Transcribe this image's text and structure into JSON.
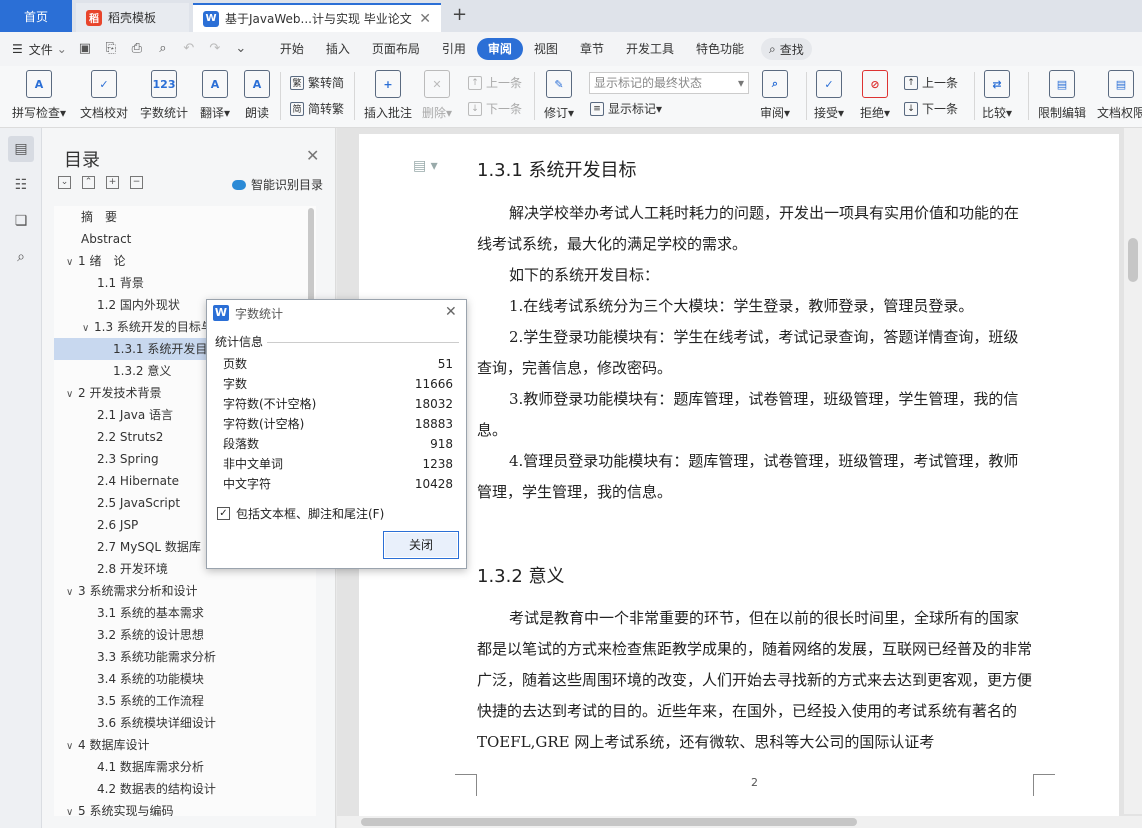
{
  "tabs": {
    "home": "首页",
    "template": "稻壳模板",
    "doc": "基于JavaWeb...计与实现 毕业论文"
  },
  "menubar": {
    "file": "文件",
    "menus": [
      "开始",
      "插入",
      "页面布局",
      "引用",
      "审阅",
      "视图",
      "章节",
      "开发工具",
      "特色功能"
    ],
    "search": "查找"
  },
  "ribbon": {
    "spellcheck": "拼写检查",
    "proofread": "文档校对",
    "wordcount": "字数统计",
    "translate": "翻译",
    "read": "朗读",
    "trad": "繁转简",
    "simp": "简转繁",
    "insert_comment": "插入批注",
    "delete": "删除",
    "prev1": "上一条",
    "next1": "下一条",
    "revise": "修订",
    "mark_status": "显示标记的最终状态",
    "show_marks": "显示标记",
    "review": "审阅",
    "accept": "接受",
    "reject": "拒绝",
    "prev2": "上一条",
    "next2": "下一条",
    "compare": "比较",
    "restrict": "限制编辑",
    "doc_perm": "文档权限"
  },
  "toc": {
    "title": "目录",
    "smart": "智能识别目录",
    "items": [
      {
        "text": "摘　要",
        "level": 0,
        "arrow": ""
      },
      {
        "text": "Abstract",
        "level": 0,
        "arrow": ""
      },
      {
        "text": "1 绪　论",
        "level": 0,
        "arrow": "∨"
      },
      {
        "text": "1.1 背景",
        "level": 1,
        "arrow": ""
      },
      {
        "text": "1.2 国内外现状",
        "level": 1,
        "arrow": ""
      },
      {
        "text": "1.3 系统开发的目标与意义",
        "level": 1,
        "arrow": "∨"
      },
      {
        "text": "1.3.1 系统开发目标",
        "level": 2,
        "arrow": "",
        "selected": true
      },
      {
        "text": "1.3.2 意义",
        "level": 2,
        "arrow": ""
      },
      {
        "text": "2 开发技术背景",
        "level": 0,
        "arrow": "∨"
      },
      {
        "text": "2.1 Java 语言",
        "level": 1,
        "arrow": ""
      },
      {
        "text": "2.2 Struts2",
        "level": 1,
        "arrow": ""
      },
      {
        "text": "2.3 Spring",
        "level": 1,
        "arrow": ""
      },
      {
        "text": "2.4 Hibernate",
        "level": 1,
        "arrow": ""
      },
      {
        "text": "2.5 JavaScript",
        "level": 1,
        "arrow": ""
      },
      {
        "text": "2.6 JSP",
        "level": 1,
        "arrow": ""
      },
      {
        "text": "2.7 MySQL 数据库",
        "level": 1,
        "arrow": ""
      },
      {
        "text": "2.8 开发环境",
        "level": 1,
        "arrow": ""
      },
      {
        "text": "3 系统需求分析和设计",
        "level": 0,
        "arrow": "∨"
      },
      {
        "text": "3.1 系统的基本需求",
        "level": 1,
        "arrow": ""
      },
      {
        "text": "3.2 系统的设计思想",
        "level": 1,
        "arrow": ""
      },
      {
        "text": "3.3 系统功能需求分析",
        "level": 1,
        "arrow": ""
      },
      {
        "text": "3.4 系统的功能模块",
        "level": 1,
        "arrow": ""
      },
      {
        "text": "3.5 系统的工作流程",
        "level": 1,
        "arrow": ""
      },
      {
        "text": "3.6 系统模块详细设计",
        "level": 1,
        "arrow": ""
      },
      {
        "text": "4 数据库设计",
        "level": 0,
        "arrow": "∨"
      },
      {
        "text": "4.1 数据库需求分析",
        "level": 1,
        "arrow": ""
      },
      {
        "text": "4.2 数据表的结构设计",
        "level": 1,
        "arrow": ""
      },
      {
        "text": "5 系统实现与编码",
        "level": 0,
        "arrow": "∨"
      }
    ]
  },
  "document": {
    "h1": "1.3.1 系统开发目标",
    "p1": "解决学校举办考试人工耗时耗力的问题，开发出一项具有实用价值和功能的在线考试系统，最大化的满足学校的需求。",
    "p2": "如下的系统开发目标：",
    "p3": "1.在线考试系统分为三个大模块：学生登录，教师登录，管理员登录。",
    "p4": "2.学生登录功能模块有：学生在线考试，考试记录查询，答题详情查询，班级查询，完善信息，修改密码。",
    "p5": "3.教师登录功能模块有：题库管理，试卷管理，班级管理，学生管理，我的信息。",
    "p6": "4.管理员登录功能模块有：题库管理，试卷管理，班级管理，考试管理，教师管理，学生管理，我的信息。",
    "h2": "1.3.2 意义",
    "p7": "考试是教育中一个非常重要的环节，但在以前的很长时间里，全球所有的国家都是以笔试的方式来检查焦距教学成果的，随着网络的发展，互联网已经普及的非常广泛，随着这些周围环境的改变，人们开始去寻找新的方式来去达到更客观，更方便快捷的去达到考试的目的。近些年来，在国外，已经投入使用的考试系统有著名的 TOEFL,GRE 网上考试系统，还有微软、思科等大公司的国际认证考",
    "page_number": "2"
  },
  "dialog": {
    "title": "字数统计",
    "section": "统计信息",
    "rows": [
      {
        "label": "页数",
        "value": "51"
      },
      {
        "label": "字数",
        "value": "11666"
      },
      {
        "label": "字符数(不计空格)",
        "value": "18032"
      },
      {
        "label": "字符数(计空格)",
        "value": "18883"
      },
      {
        "label": "段落数",
        "value": "918"
      },
      {
        "label": "非中文单词",
        "value": "1238"
      },
      {
        "label": "中文字符",
        "value": "10428"
      }
    ],
    "checkbox_label": "包括文本框、脚注和尾注(F)",
    "close_button": "关闭"
  },
  "colors": {
    "accent": "#2b6fd6"
  }
}
